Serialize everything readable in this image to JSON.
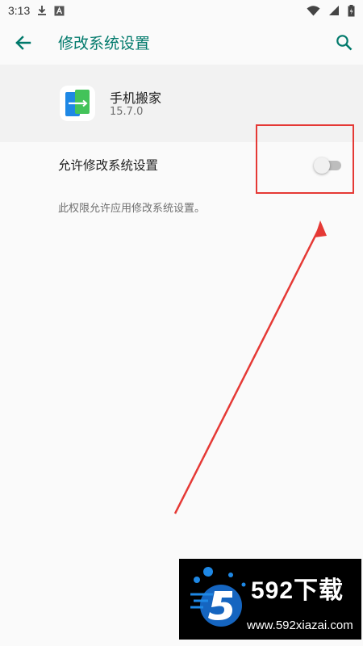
{
  "status_bar": {
    "time": "3:13",
    "icons": [
      "download-icon",
      "a-box-icon",
      "wifi-icon",
      "signal-icon",
      "battery-icon"
    ]
  },
  "app_bar": {
    "title": "修改系统设置",
    "back_icon": "back-arrow-icon",
    "search_icon": "search-icon",
    "accent_color": "#00796b"
  },
  "app_info": {
    "name": "手机搬家",
    "version": "15.7.0"
  },
  "setting": {
    "label": "允许修改系统设置",
    "enabled": false,
    "description": "此权限允许应用修改系统设置。"
  },
  "annotation": {
    "highlight_color": "#e53935"
  },
  "watermark": {
    "brand": "592下载",
    "url": "www.592xiazai.com"
  }
}
